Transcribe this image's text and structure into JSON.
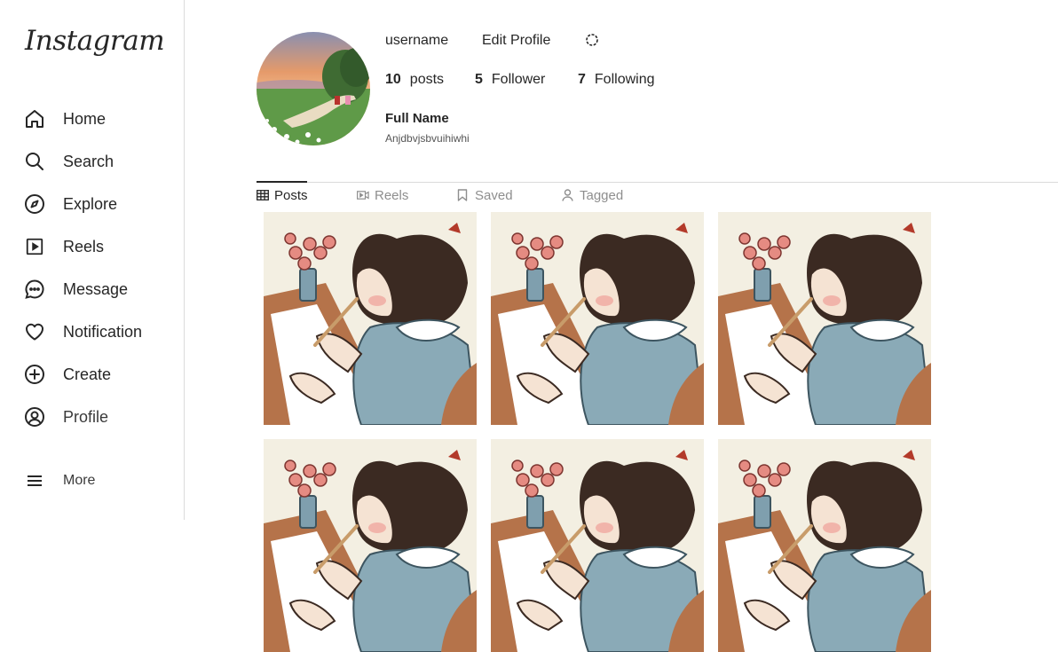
{
  "brand": {
    "logo_text": "Instagram"
  },
  "sidebar": {
    "items": [
      {
        "label": "Home",
        "icon": "home-icon"
      },
      {
        "label": "Search",
        "icon": "search-icon"
      },
      {
        "label": "Explore",
        "icon": "compass-icon"
      },
      {
        "label": "Reels",
        "icon": "reels-icon"
      },
      {
        "label": "Message",
        "icon": "message-icon"
      },
      {
        "label": "Notification",
        "icon": "heart-icon"
      },
      {
        "label": "Create",
        "icon": "plus-circle-icon"
      },
      {
        "label": "Profile",
        "icon": "profile-icon"
      }
    ],
    "more_label": "More"
  },
  "profile": {
    "username": "username",
    "edit_label": "Edit Profile",
    "settings_icon": "settings-icon",
    "posts_count": "10",
    "posts_label": "posts",
    "followers_count": "5",
    "followers_label": "Follower",
    "following_count": "7",
    "following_label": "Following",
    "full_name": "Full Name",
    "bio": "Anjdbvjsbvuihiwhi"
  },
  "tabs": [
    {
      "label": "Posts",
      "icon": "grid-icon",
      "active": true
    },
    {
      "label": "Reels",
      "icon": "video-icon",
      "active": false
    },
    {
      "label": "Saved",
      "icon": "bookmark-icon",
      "active": false
    },
    {
      "label": "Tagged",
      "icon": "person-icon",
      "active": false
    }
  ],
  "colors": {
    "text": "#262626",
    "muted": "#8e8e8e",
    "border": "#dbdbdb"
  }
}
